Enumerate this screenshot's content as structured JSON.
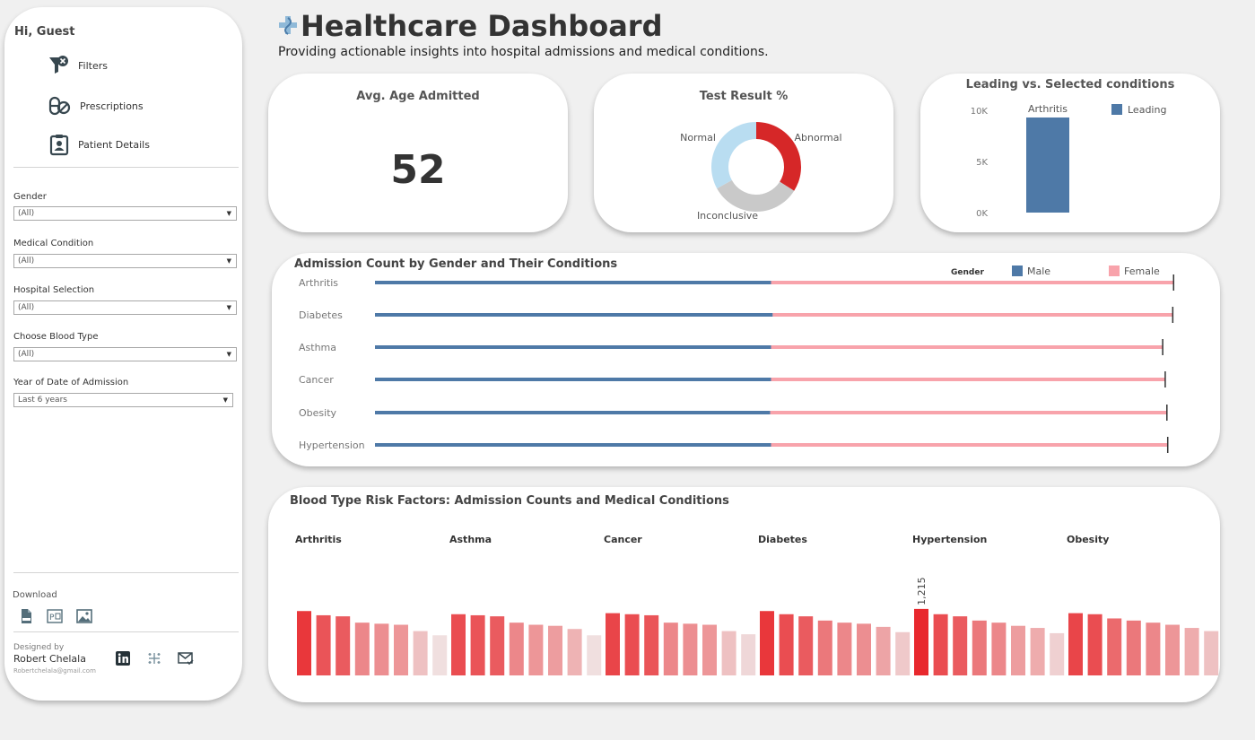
{
  "header": {
    "title": "Healthcare Dashboard",
    "subtitle": "Providing actionable insights into hospital admissions and medical conditions."
  },
  "sidebar": {
    "greeting": "Hi, Guest",
    "nav": [
      {
        "label": "Filters",
        "icon": "filter-clear-icon"
      },
      {
        "label": "Prescriptions",
        "icon": "pills-icon"
      },
      {
        "label": "Patient Details",
        "icon": "clipboard-user-icon"
      }
    ],
    "filters": [
      {
        "label": "Gender",
        "value": "(All)"
      },
      {
        "label": "Medical Condition",
        "value": "(All)"
      },
      {
        "label": "Hospital Selection",
        "value": "(All)"
      },
      {
        "label": "Choose Blood Type",
        "value": "(All)"
      },
      {
        "label": "Year of Date of Admission",
        "value": "Last 6 years"
      }
    ],
    "download_label": "Download",
    "download_icons": [
      "pdf-icon",
      "powerpoint-icon",
      "image-icon"
    ],
    "designed_by_label": "Designed by",
    "designer": "Robert Chelala",
    "email": "Robertchelala@gmail.com",
    "social_icons": [
      "linkedin-icon",
      "tableau-icon",
      "mail-icon"
    ]
  },
  "kpis": {
    "avg_age_title": "Avg. Age Admitted",
    "avg_age_value": "52",
    "test_result_title": "Test Result %",
    "leading_title": "Leading vs. Selected conditions"
  },
  "colors": {
    "male": "#4e79a7",
    "female": "#f8a3ab",
    "abnormal": "#d62728",
    "normal": "#b9ddf1",
    "inconclusive": "#c9c9c9",
    "leading": "#4e79a7"
  },
  "chart_data": [
    {
      "type": "pie",
      "title": "Test Result %",
      "labels": [
        "Abnormal",
        "Inconclusive",
        "Normal"
      ],
      "values": [
        34,
        33,
        33
      ]
    },
    {
      "type": "bar",
      "title": "Leading vs. Selected conditions",
      "categories": [
        "Arthritis"
      ],
      "values": [
        9300
      ],
      "ylim": [
        0,
        11000
      ],
      "yticks": [
        0,
        5000,
        10000
      ],
      "ytick_labels": [
        "0K",
        "5K",
        "10K"
      ],
      "legend": [
        "Leading"
      ],
      "legend_position": "top-right"
    },
    {
      "type": "bar",
      "orientation": "horizontal-stacked",
      "title": "Admission Count by Gender and Their Conditions",
      "legend_title": "Gender",
      "legend_position": "top-right",
      "categories": [
        "Arthritis",
        "Diabetes",
        "Asthma",
        "Cancer",
        "Obesity",
        "Hypertension"
      ],
      "series": [
        {
          "name": "Male",
          "values": [
            4720,
            4740,
            4720,
            4720,
            4710,
            4720
          ]
        },
        {
          "name": "Female",
          "values": [
            4800,
            4770,
            4670,
            4700,
            4730,
            4730
          ]
        }
      ],
      "xlim": [
        0,
        9600
      ],
      "grid": false
    },
    {
      "type": "bar",
      "title": "Blood Type Risk Factors: Admission Counts and Medical Conditions",
      "groups": [
        "Arthritis",
        "Asthma",
        "Cancer",
        "Diabetes",
        "Hypertension",
        "Obesity"
      ],
      "bars_per_group": 8,
      "values": [
        [
          1205,
          1185,
          1180,
          1150,
          1145,
          1140,
          1110,
          1090
        ],
        [
          1190,
          1185,
          1180,
          1150,
          1140,
          1135,
          1120,
          1090
        ],
        [
          1195,
          1190,
          1185,
          1150,
          1145,
          1140,
          1110,
          1095
        ],
        [
          1205,
          1190,
          1180,
          1160,
          1150,
          1145,
          1130,
          1105
        ],
        [
          1215,
          1190,
          1180,
          1160,
          1150,
          1135,
          1125,
          1100
        ],
        [
          1195,
          1190,
          1170,
          1160,
          1150,
          1140,
          1125,
          1110
        ]
      ],
      "annotation": {
        "group": "Hypertension",
        "index": 0,
        "label": "1,215"
      },
      "ylim": [
        0,
        1240
      ]
    }
  ]
}
